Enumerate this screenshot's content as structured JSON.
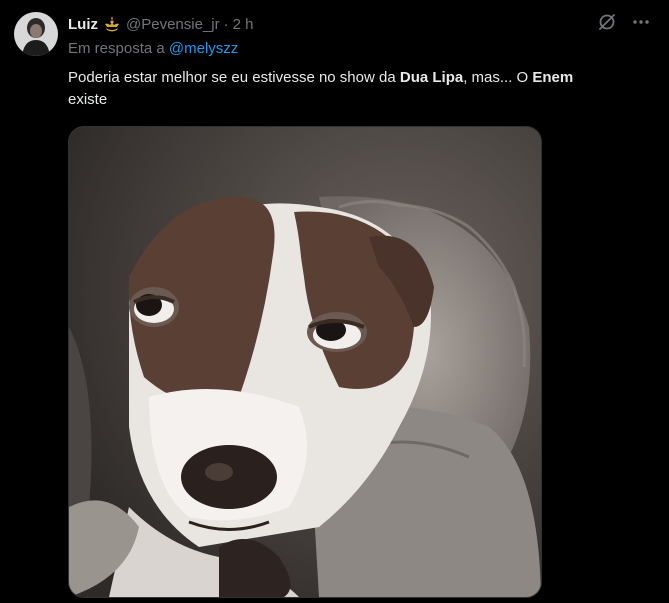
{
  "tweet": {
    "display_name": "Luiz",
    "badge_icon": "crown-ship-icon",
    "handle": "@Pevensie_jr",
    "separator": "·",
    "time": "2 h",
    "reply_prefix": "Em resposta a",
    "reply_mention": "@melyszz",
    "text_parts": [
      {
        "text": "Poderia estar melhor se eu estivesse no show da ",
        "bold": false
      },
      {
        "text": "Dua Lipa",
        "bold": true
      },
      {
        "text": ", mas... O ",
        "bold": false
      },
      {
        "text": "Enem",
        "bold": true
      },
      {
        "text": " existe",
        "bold": false
      }
    ],
    "media_icon": "sad-dog-gif-image",
    "actions": [
      "grok-icon",
      "more-options-icon"
    ]
  },
  "colors": {
    "background": "#000000",
    "text": "#e7e9ea",
    "muted": "#71767b",
    "link": "#1d9bf0",
    "badge": "#d4a72c"
  }
}
